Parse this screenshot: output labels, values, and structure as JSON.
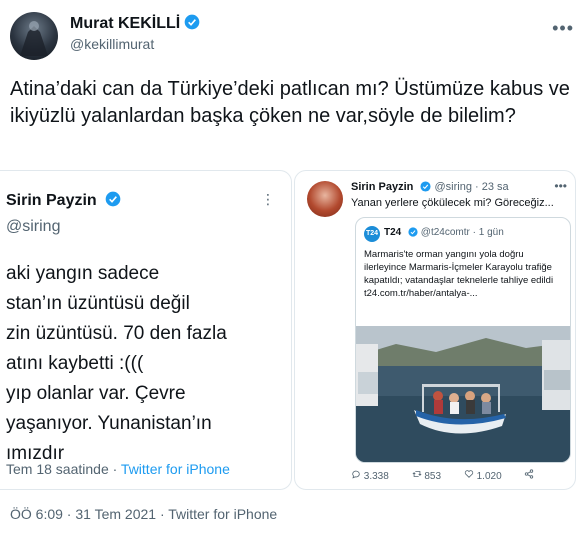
{
  "author": {
    "name": "Murat KEKİLLİ",
    "handle": "@kekillimurat"
  },
  "menu_icon": "more-icon",
  "tweet_text": "Atina’daki can da Türkiye’deki patlıcan mı? Üstümüze kabus ve ikiyüzlü yalanlardan başka çöken ne var,söyle de bilelim?",
  "left_image": {
    "name": "Sirin Payzin",
    "handle": "@siring",
    "lines": [
      "aki yangın sadece",
      "stan’ın üzüntüsü değil",
      "zin üzüntüsü. 70 den fazla",
      "atını kaybetti :(((",
      "yıp olanlar var. Çevre",
      "yaşanıyor. Yunanistan’ın",
      "ımızdır"
    ],
    "footer_time": "Tem 18 saatinde · ",
    "footer_source": "Twitter for iPhone"
  },
  "right_image": {
    "name": "Sirin Payzin",
    "handle": "@siring · 23 sa",
    "text": "Yanan yerlere çökülecek mi? Göreceğiz...",
    "quoted": {
      "logo": "T24",
      "name": "T24",
      "handle": "@t24comtr · 1 gün",
      "text": "Marmaris'te orman yangını yola doğru ilerleyince Marmaris-İçmeler Karayolu trafiğe kapatıldı; vatandaşlar teknelerle tahliye edildi",
      "link": "t24.com.tr/haber/antalya-..."
    },
    "replies": "3.338",
    "retweets": "853",
    "likes": "1.020"
  },
  "meta": "ÖÖ 6:09 · 31 Tem 2021 · Twitter for iPhone",
  "colors": {
    "accent": "#1d9bf0",
    "text": "#0f1419",
    "muted": "#536471"
  }
}
